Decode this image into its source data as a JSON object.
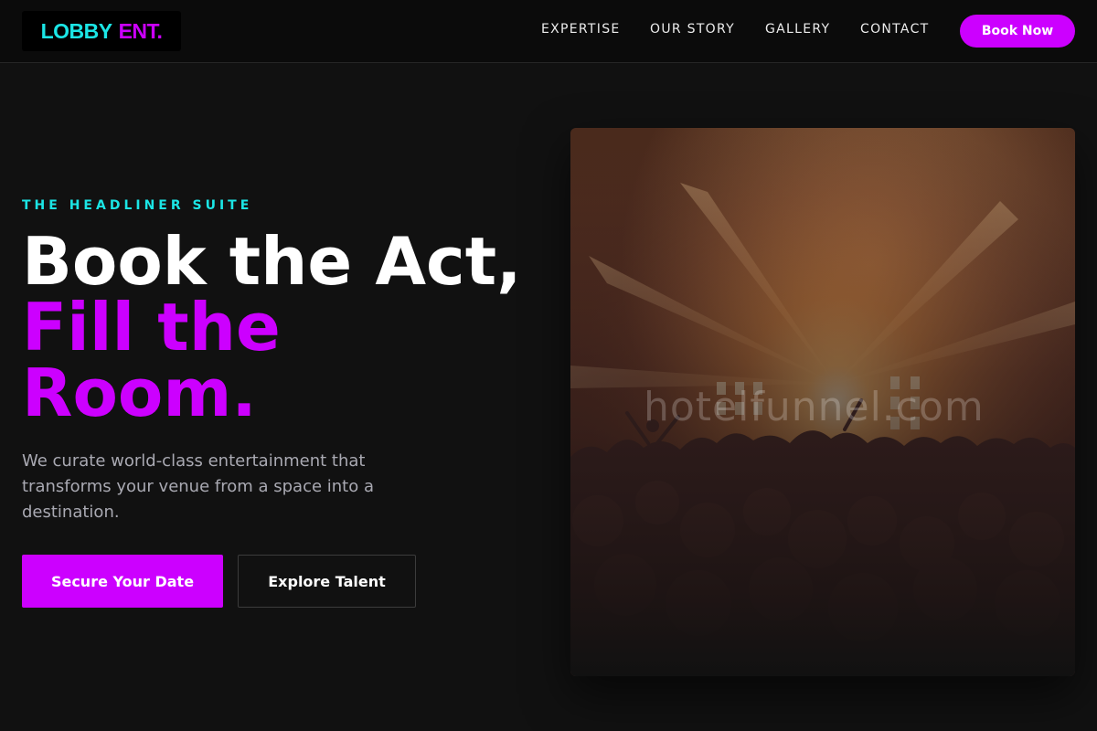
{
  "header": {
    "logo": {
      "part1": "LOBBY",
      "part2": "ENT."
    },
    "nav": [
      {
        "label": "EXPERTISE"
      },
      {
        "label": "OUR STORY"
      },
      {
        "label": "GALLERY"
      },
      {
        "label": "CONTACT"
      }
    ],
    "cta_label": "Book Now"
  },
  "hero": {
    "eyebrow": "THE HEADLINER SUITE",
    "headline_line1": "Book the Act,",
    "headline_line2": "Fill the",
    "headline_line3": "Room.",
    "lead": "We curate world-class entertainment that transforms your venue from a space into a destination.",
    "primary_button": "Secure Your Date",
    "secondary_button": "Explore Talent",
    "image": {
      "subject": "concert crowd under stage lights",
      "watermark": "hotelfunnel.com"
    }
  },
  "colors": {
    "background": "#111111",
    "header_bg": "#0b0b0b",
    "accent_purple": "#cc00ff",
    "accent_cyan": "#1be5e5",
    "body_text": "#a9a9b2"
  }
}
